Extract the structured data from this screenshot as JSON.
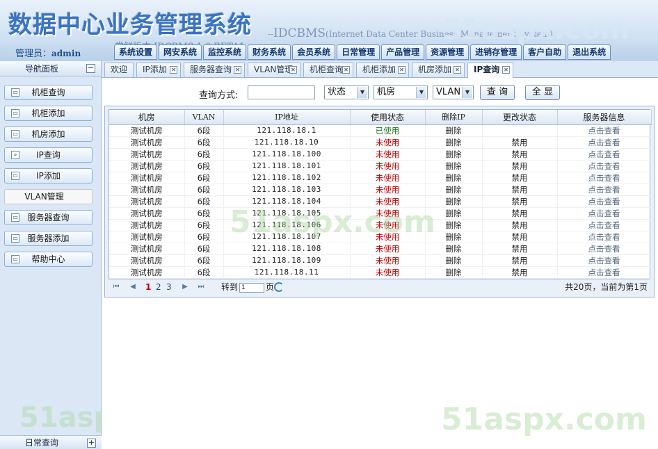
{
  "header": {
    "logo_title": "数据中心业务管理系统",
    "logo_sub_main": "IDCBMS",
    "logo_sub_paren": "(Internet Data Center Business Management System)",
    "logo_version": "尝鲜版本  IDCBMS 1.0 BETA1",
    "admin_label": "管理员：",
    "admin_name": "admin",
    "watermark": "51aspx.com"
  },
  "nav": [
    "系统设置",
    "网安系统",
    "监控系统",
    "财务系统",
    "会员系统",
    "日常管理",
    "产品管理",
    "资源管理",
    "进销存管理",
    "客户自助",
    "退出系统"
  ],
  "sidebar": {
    "title": "导航面板",
    "collapse": "−",
    "items": [
      {
        "label": "机柜查询",
        "icon": "window-icon"
      },
      {
        "label": "机柜添加",
        "icon": "window-icon"
      },
      {
        "label": "机房添加",
        "icon": "window-icon"
      },
      {
        "label": "IP查询",
        "icon": "double-chevron-right-icon"
      },
      {
        "label": "IP添加",
        "icon": "window-icon"
      },
      {
        "label": "VLAN管理",
        "icon": ""
      },
      {
        "label": "服务器查询",
        "icon": "window-icon"
      },
      {
        "label": "服务器添加",
        "icon": "window-icon"
      },
      {
        "label": "帮助中心",
        "icon": "window-icon"
      }
    ],
    "footer": "日常查询",
    "expand": "+"
  },
  "tabs": [
    {
      "label": "欢迎"
    },
    {
      "label": "IP添加",
      "close": "✕"
    },
    {
      "label": "服务器查询",
      "close": "✕"
    },
    {
      "label": "VLAN管理",
      "close": "✕"
    },
    {
      "label": "机柜查询",
      "close": "✕"
    },
    {
      "label": "机柜添加",
      "close": "✕"
    },
    {
      "label": "机房添加",
      "close": "✕"
    },
    {
      "label": "IP查询",
      "close": "✕"
    }
  ],
  "query": {
    "label": "查询方式:",
    "input_value": "",
    "select_status": "状态",
    "select_room": "机房",
    "select_vlan": "VLAN",
    "query_button": "查 询",
    "show_all_button": "全 显"
  },
  "table": {
    "headers": [
      "机房",
      "VLAN",
      "IP地址",
      "使用状态",
      "删除IP",
      "更改状态",
      "服务器信息"
    ],
    "rows": [
      {
        "room": "测试机房",
        "vlan": "6段",
        "ip": "121.118.18.1",
        "status": "已使用",
        "used": true,
        "delete": "删除",
        "change": "",
        "info": "点击查看"
      },
      {
        "room": "测试机房",
        "vlan": "6段",
        "ip": "121.118.18.10",
        "status": "未使用",
        "used": false,
        "delete": "删除",
        "change": "禁用",
        "info": "点击查看"
      },
      {
        "room": "测试机房",
        "vlan": "6段",
        "ip": "121.118.18.100",
        "status": "未使用",
        "used": false,
        "delete": "删除",
        "change": "禁用",
        "info": "点击查看"
      },
      {
        "room": "测试机房",
        "vlan": "6段",
        "ip": "121.118.18.101",
        "status": "未使用",
        "used": false,
        "delete": "删除",
        "change": "禁用",
        "info": "点击查看"
      },
      {
        "room": "测试机房",
        "vlan": "6段",
        "ip": "121.118.18.102",
        "status": "未使用",
        "used": false,
        "delete": "删除",
        "change": "禁用",
        "info": "点击查看"
      },
      {
        "room": "测试机房",
        "vlan": "6段",
        "ip": "121.118.18.103",
        "status": "未使用",
        "used": false,
        "delete": "删除",
        "change": "禁用",
        "info": "点击查看"
      },
      {
        "room": "测试机房",
        "vlan": "6段",
        "ip": "121.118.18.104",
        "status": "未使用",
        "used": false,
        "delete": "删除",
        "change": "禁用",
        "info": "点击查看"
      },
      {
        "room": "测试机房",
        "vlan": "6段",
        "ip": "121.118.18.105",
        "status": "未使用",
        "used": false,
        "delete": "删除",
        "change": "禁用",
        "info": "点击查看"
      },
      {
        "room": "测试机房",
        "vlan": "6段",
        "ip": "121.118.18.106",
        "status": "未使用",
        "used": false,
        "delete": "删除",
        "change": "禁用",
        "info": "点击查看"
      },
      {
        "room": "测试机房",
        "vlan": "6段",
        "ip": "121.118.18.107",
        "status": "未使用",
        "used": false,
        "delete": "删除",
        "change": "禁用",
        "info": "点击查看"
      },
      {
        "room": "测试机房",
        "vlan": "6段",
        "ip": "121.118.18.108",
        "status": "未使用",
        "used": false,
        "delete": "删除",
        "change": "禁用",
        "info": "点击查看"
      },
      {
        "room": "测试机房",
        "vlan": "6段",
        "ip": "121.118.18.109",
        "status": "未使用",
        "used": false,
        "delete": "删除",
        "change": "禁用",
        "info": "点击查看"
      },
      {
        "room": "测试机房",
        "vlan": "6段",
        "ip": "121.118.18.11",
        "status": "未使用",
        "used": false,
        "delete": "删除",
        "change": "禁用",
        "info": "点击查看"
      }
    ]
  },
  "pager": {
    "pages": [
      "1",
      "2",
      "3"
    ],
    "current": "1",
    "goto_label": "转到",
    "goto_value": "1",
    "page_suffix": "页",
    "total": "共20页，当前为第1页"
  },
  "colors": {
    "used": "#1f7a1f",
    "unused": "#c00000",
    "accent": "#3a73c2"
  }
}
